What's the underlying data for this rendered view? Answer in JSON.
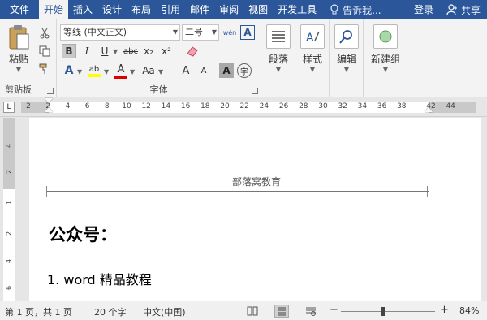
{
  "tabs": {
    "file": "文件",
    "home": "开始",
    "insert": "插入",
    "design": "设计",
    "layout": "布局",
    "references": "引用",
    "mailings": "邮件",
    "review": "审阅",
    "view": "视图",
    "developer": "开发工具",
    "tell_me": "告诉我...",
    "login": "登录",
    "share": "共享"
  },
  "clipboard": {
    "paste_label": "粘贴",
    "group_label": "剪贴板"
  },
  "font": {
    "font_name": "等线 (中文正文)",
    "font_size": "二号",
    "group_label": "字体",
    "bold": "B",
    "italic": "I",
    "underline": "U",
    "strikethrough": "abc",
    "subscript": "x₂",
    "superscript": "x²",
    "change_case": "Aa",
    "grow": "A",
    "shrink": "A",
    "phonetic": "wén",
    "border_char": "A",
    "shading_char": "A",
    "enclosed_char": "字"
  },
  "paragraph": {
    "label": "段落"
  },
  "styles": {
    "label": "样式"
  },
  "editing": {
    "label": "编辑"
  },
  "new_group": {
    "label": "新建组"
  },
  "ruler": {
    "corner": "L",
    "ticks": [
      "2",
      "2",
      "4",
      "6",
      "8",
      "10",
      "12",
      "14",
      "16",
      "18",
      "20",
      "22",
      "24",
      "26",
      "28",
      "30",
      "32",
      "34",
      "36",
      "38",
      "42",
      "44"
    ]
  },
  "vruler": {
    "ticks": [
      "4",
      "2",
      "1",
      "2",
      "4",
      "6"
    ]
  },
  "document": {
    "header": "部落窝教育",
    "heading": "公众号：",
    "list_item": "1. word 精品教程"
  },
  "status": {
    "page": "第 1 页，共 1 页",
    "words": "20 个字",
    "language": "中文(中国)",
    "zoom_minus": "−",
    "zoom_plus": "+",
    "zoom": "84%",
    "zoom_fraction": 0.45
  }
}
